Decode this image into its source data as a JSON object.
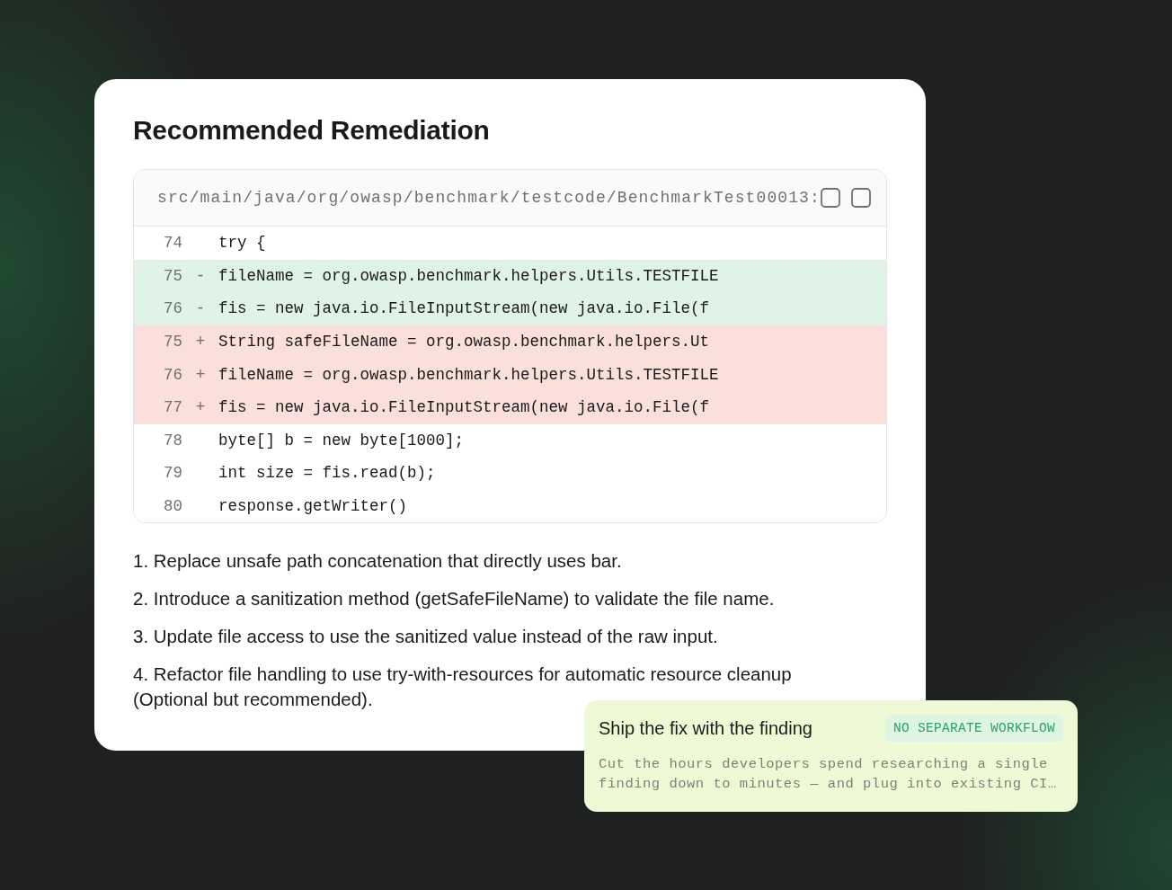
{
  "card": {
    "title": "Recommended Remediation",
    "code": {
      "file_path": "src/main/java/org/owasp/benchmark/testcode/BenchmarkTest00013:",
      "lines": [
        {
          "number": "74",
          "kind": "context",
          "code": "try {"
        },
        {
          "number": "75",
          "kind": "removed",
          "sign": "-",
          "code": "fileName = org.owasp.benchmark.helpers.Utils.TESTFILE"
        },
        {
          "number": "76",
          "kind": "removed",
          "sign": "-",
          "code": "fis = new java.io.FileInputStream(new java.io.File(f"
        },
        {
          "number": "75",
          "kind": "added",
          "sign": "+",
          "code": "String safeFileName = org.owasp.benchmark.helpers.Ut"
        },
        {
          "number": "76",
          "kind": "added",
          "sign": "+",
          "code": "fileName = org.owasp.benchmark.helpers.Utils.TESTFILE"
        },
        {
          "number": "77",
          "kind": "added",
          "sign": "+",
          "code": "fis = new java.io.FileInputStream(new java.io.File(f"
        },
        {
          "number": "78",
          "kind": "context",
          "code": "byte[] b = new byte[1000];"
        },
        {
          "number": "79",
          "kind": "context",
          "code": "int size = fis.read(b);"
        },
        {
          "number": "80",
          "kind": "context",
          "code": "response.getWriter()"
        }
      ]
    },
    "steps": [
      "1. Replace unsafe path concatenation that directly uses bar.",
      "2. Introduce a sanitization method (getSafeFileName) to validate the file name.",
      "3. Update file access to use the sanitized value instead of the raw input.",
      "4. Refactor file handling to use try-with-resources for automatic resource cleanup (Optional but recommended)."
    ]
  },
  "callout": {
    "title": "Ship the fix with the finding",
    "badge": "NO SEPARATE WORKFLOW",
    "body": "Cut the hours developers spend researching a single finding down to minutes — and plug into existing CI…"
  }
}
